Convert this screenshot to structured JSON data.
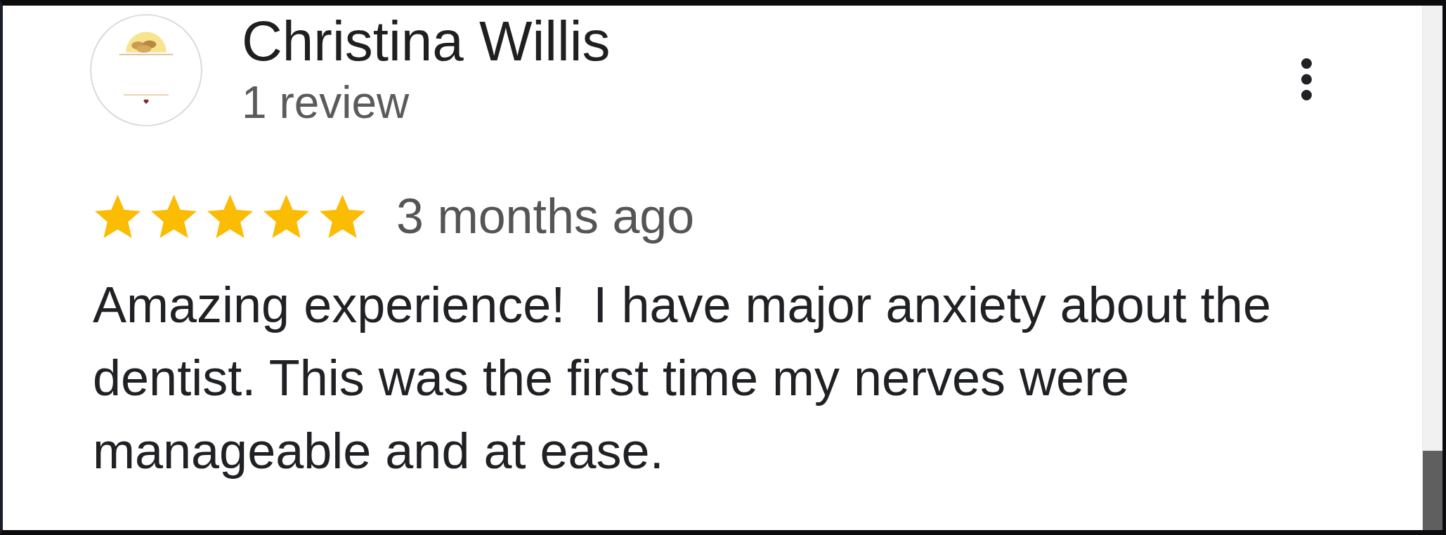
{
  "reviewer": {
    "name": "Christina Willis",
    "review_count": "1 review"
  },
  "review": {
    "stars": 5,
    "time": "3 months ago",
    "text": "Amazing experience!  I have major anxiety about the dentist. This was the first time my nerves were manageable and at ease."
  }
}
